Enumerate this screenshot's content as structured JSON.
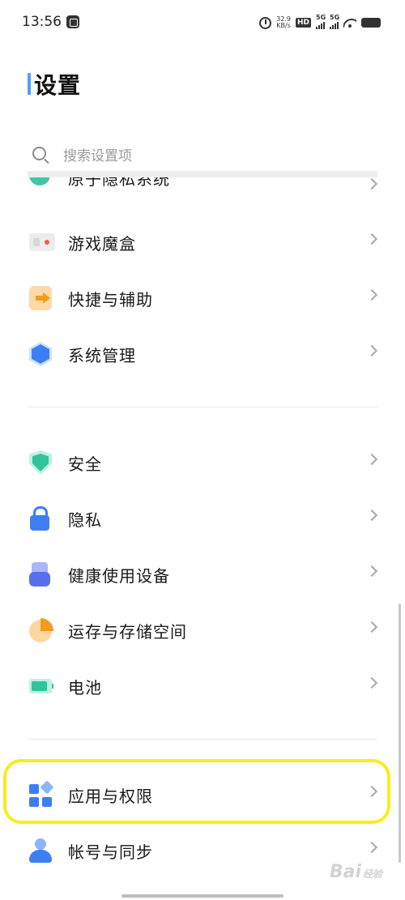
{
  "status_bar": {
    "time": "13:56",
    "speed_value": "32.9",
    "speed_unit": "KB/s",
    "hd_label": "HD",
    "signal_1": "5G",
    "signal_2": "5G"
  },
  "header": {
    "title": "设置"
  },
  "search": {
    "placeholder": "搜索设置项"
  },
  "items": {
    "privacy_system": "原子隐私系统",
    "game_box": "游戏魔盒",
    "shortcuts": "快捷与辅助",
    "system_management": "系统管理",
    "security": "安全",
    "privacy": "隐私",
    "health_devices": "健康使用设备",
    "memory_storage": "运存与存储空间",
    "battery": "电池",
    "apps_permissions": "应用与权限",
    "account_sync": "帐号与同步"
  },
  "watermark": {
    "text": "Bai",
    "suffix": "经验"
  },
  "colors": {
    "accent": "#4da0ff",
    "highlight": "#f5ee1c",
    "green": "#2fc49b",
    "blue": "#3d7ef5",
    "orange": "#f59a1c"
  }
}
